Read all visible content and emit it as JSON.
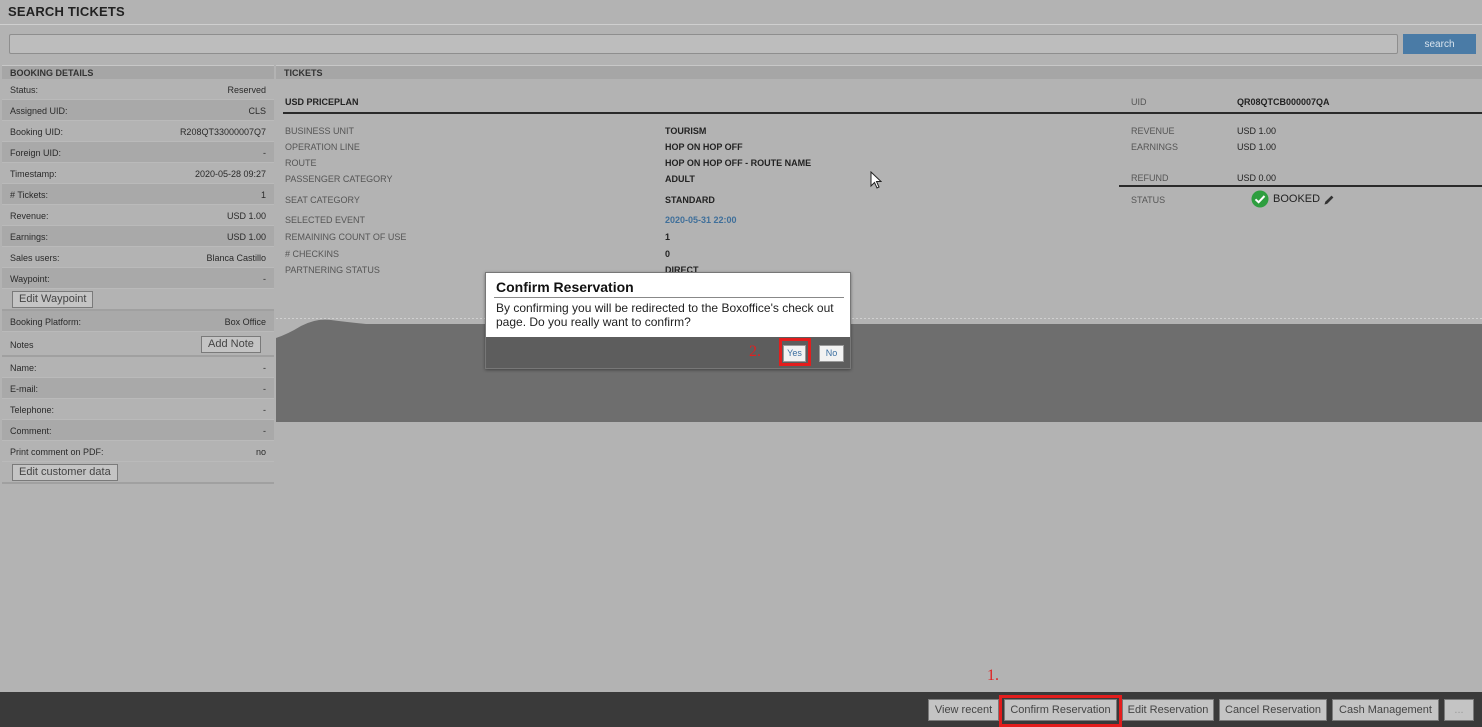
{
  "page": {
    "title": "SEARCH TICKETS"
  },
  "search": {
    "value": "",
    "placeholder": "",
    "button_label": "search"
  },
  "booking": {
    "header": "BOOKING DETAILS",
    "rows_a": [
      {
        "label": "Status:",
        "value": "Reserved"
      },
      {
        "label": "Assigned UID:",
        "value": "CLS"
      },
      {
        "label": "Booking UID:",
        "value": "R208QT33000007Q7"
      },
      {
        "label": "Foreign UID:",
        "value": "-"
      },
      {
        "label": "Timestamp:",
        "value": "2020-05-28 09:27"
      },
      {
        "label": "# Tickets:",
        "value": "1"
      },
      {
        "label": "Revenue:",
        "value": "USD 1.00"
      },
      {
        "label": "Earnings:",
        "value": "USD 1.00"
      },
      {
        "label": "Sales users:",
        "value": "Blanca Castillo"
      },
      {
        "label": "Waypoint:",
        "value": "-"
      }
    ],
    "edit_waypoint_label": "Edit Waypoint",
    "platform": {
      "label": "Booking Platform:",
      "value": "Box Office"
    },
    "notes": {
      "label": "Notes",
      "button_label": "Add Note"
    },
    "rows_b": [
      {
        "label": "Name:",
        "value": "-"
      },
      {
        "label": "E-mail:",
        "value": "-"
      },
      {
        "label": "Telephone:",
        "value": "-"
      },
      {
        "label": "Comment:",
        "value": "-"
      },
      {
        "label": "Print comment on PDF:",
        "value": "no"
      }
    ],
    "edit_customer_label": "Edit customer data"
  },
  "tickets": {
    "header": "TICKETS",
    "priceplan": "USD PRICEPLAN",
    "uid_label": "UID",
    "uid_value": "QR08QTCB000007QA",
    "fields": [
      {
        "label": "BUSINESS UNIT",
        "value": "TOURISM"
      },
      {
        "label": "OPERATION LINE",
        "value": "HOP ON HOP OFF"
      },
      {
        "label": "ROUTE",
        "value": "HOP ON HOP OFF - ROUTE NAME"
      },
      {
        "label": "PASSENGER CATEGORY",
        "value": "ADULT"
      },
      {
        "label": "SEAT CATEGORY",
        "value": "STANDARD"
      },
      {
        "label": "SELECTED EVENT",
        "value": "2020-05-31 22:00"
      },
      {
        "label": "REMAINING COUNT OF USE",
        "value": "1"
      },
      {
        "label": "# CHECKINS",
        "value": "0"
      },
      {
        "label": "PARTNERING STATUS",
        "value": "DIRECT"
      }
    ],
    "right_fields": [
      {
        "label": "REVENUE",
        "value": "USD 1.00"
      },
      {
        "label": "EARNINGS",
        "value": "USD 1.00"
      },
      {
        "label": "REFUND",
        "value": "USD 0.00"
      }
    ],
    "status": {
      "label": "STATUS",
      "value": "BOOKED",
      "icon": "check-circle-icon",
      "edit_icon": "pencil-icon"
    }
  },
  "modal": {
    "title": "Confirm Reservation",
    "message": "By confirming you will be redirected to the Boxoffice's check out page. Do you really want to confirm?",
    "yes_label": "Yes",
    "no_label": "No"
  },
  "annotations": {
    "step1": "1.",
    "step2": "2."
  },
  "bottom_bar": {
    "view_recent": "View recent",
    "confirm": "Confirm Reservation",
    "edit": "Edit Reservation",
    "cancel": "Cancel Reservation",
    "cash": "Cash Management",
    "more": "..."
  },
  "colors": {
    "highlight": "#e31d1d",
    "search_button": "#4a7ba6",
    "booked_icon": "#2e9e3f"
  }
}
